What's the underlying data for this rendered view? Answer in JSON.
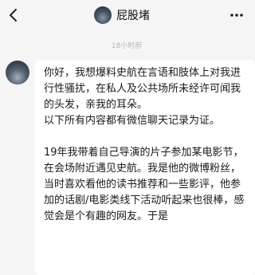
{
  "header": {
    "contact_name": "屁股堵"
  },
  "chat": {
    "timestamp": "18小时前",
    "message": "你好，我想爆料史航在言语和肢体上对我进行性骚扰，在私人及公共场所未经许可闻我的头发，亲我的耳朵。\n以下所有内容都有微信聊天记录为证。\n\n19年我带着自己导演的片子参加某电影节，在会场附近遇见史航。我是他的微博粉丝，当时喜欢看他的读书推荐和一些影评，他参加的话剧/电影类线下活动听起来也很棒，感觉会是个有趣的网友。于是"
  },
  "icons": {
    "back": "chevron-left-icon",
    "more": "more-dots-icon"
  }
}
